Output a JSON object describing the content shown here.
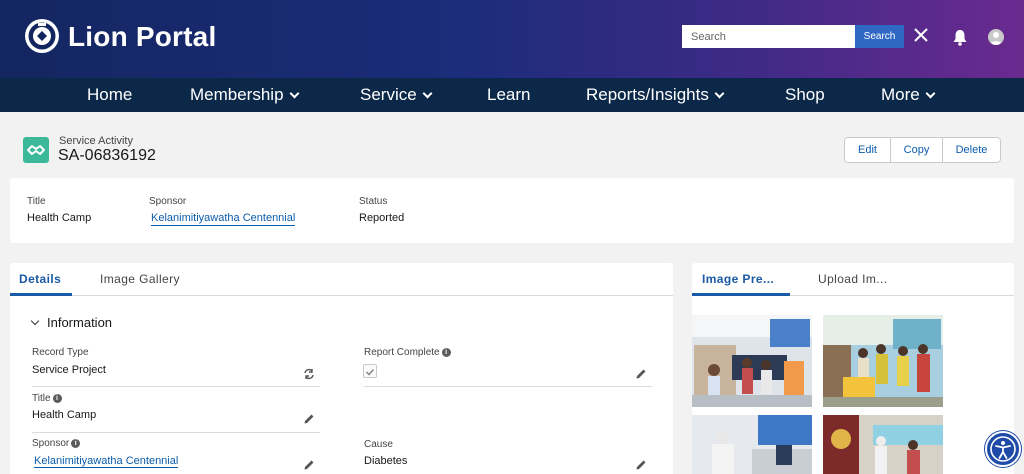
{
  "header": {
    "brand": "Lion Portal",
    "search_placeholder": "Search",
    "search_button": "Search"
  },
  "nav": {
    "items": [
      {
        "label": "Home",
        "has_dropdown": false
      },
      {
        "label": "Membership",
        "has_dropdown": true
      },
      {
        "label": "Service",
        "has_dropdown": true
      },
      {
        "label": "Learn",
        "has_dropdown": false
      },
      {
        "label": "Reports/Insights",
        "has_dropdown": true
      },
      {
        "label": "Shop",
        "has_dropdown": false
      },
      {
        "label": "More",
        "has_dropdown": true
      }
    ]
  },
  "record": {
    "type": "Service Activity",
    "id": "SA-06836192",
    "actions": {
      "edit": "Edit",
      "copy": "Copy",
      "delete": "Delete"
    }
  },
  "highlights": {
    "title_label": "Title",
    "title_value": "Health Camp",
    "sponsor_label": "Sponsor",
    "sponsor_value": "Kelanimitiyawatha Centennial",
    "status_label": "Status",
    "status_value": "Reported"
  },
  "main": {
    "tabs": [
      {
        "label": "Details",
        "active": true
      },
      {
        "label": "Image Gallery",
        "active": false
      }
    ],
    "section": "Information",
    "fields": {
      "record_type_label": "Record Type",
      "record_type_value": "Service Project",
      "report_complete_label": "Report Complete",
      "report_complete_value": true,
      "title_label": "Title",
      "title_value": "Health Camp",
      "sponsor_label": "Sponsor",
      "sponsor_value": "Kelanimitiyawatha Centennial",
      "cause_label": "Cause",
      "cause_value": "Diabetes"
    }
  },
  "side": {
    "tabs": [
      {
        "label": "Image Pre...",
        "active": true
      },
      {
        "label": "Upload Im...",
        "active": false
      }
    ]
  },
  "colors": {
    "accent": "#1a5aa6",
    "link": "#0b5cab",
    "nav_bg": "#0c2848",
    "record_icon": "#3bb99a"
  }
}
